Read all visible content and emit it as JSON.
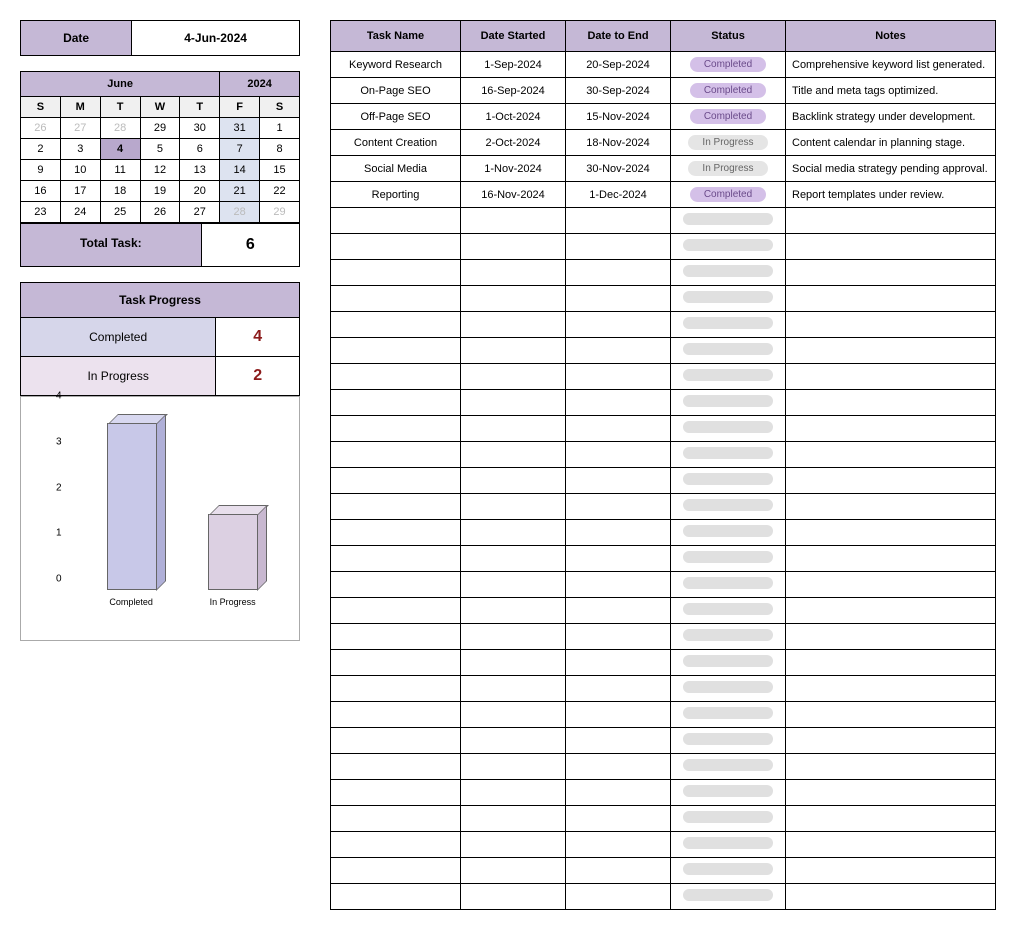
{
  "date": {
    "label": "Date",
    "value": "4-Jun-2024"
  },
  "calendar": {
    "month": "June",
    "year": "2024",
    "days": [
      "S",
      "M",
      "T",
      "W",
      "T",
      "F",
      "S"
    ],
    "weeks": [
      [
        {
          "d": "26",
          "adj": true
        },
        {
          "d": "27",
          "adj": true
        },
        {
          "d": "28",
          "adj": true
        },
        {
          "d": "29"
        },
        {
          "d": "30"
        },
        {
          "d": "31",
          "fri": true
        },
        {
          "d": "1"
        }
      ],
      [
        {
          "d": "2"
        },
        {
          "d": "3"
        },
        {
          "d": "4",
          "today": true
        },
        {
          "d": "5"
        },
        {
          "d": "6"
        },
        {
          "d": "7",
          "fri": true
        },
        {
          "d": "8"
        }
      ],
      [
        {
          "d": "9"
        },
        {
          "d": "10"
        },
        {
          "d": "11"
        },
        {
          "d": "12"
        },
        {
          "d": "13"
        },
        {
          "d": "14",
          "fri": true
        },
        {
          "d": "15"
        }
      ],
      [
        {
          "d": "16"
        },
        {
          "d": "17"
        },
        {
          "d": "18"
        },
        {
          "d": "19"
        },
        {
          "d": "20"
        },
        {
          "d": "21",
          "fri": true
        },
        {
          "d": "22"
        }
      ],
      [
        {
          "d": "23"
        },
        {
          "d": "24"
        },
        {
          "d": "25"
        },
        {
          "d": "26"
        },
        {
          "d": "27"
        },
        {
          "d": "28",
          "adj": true,
          "fri": true
        },
        {
          "d": "29",
          "adj": true
        }
      ]
    ]
  },
  "total": {
    "label": "Total Task:",
    "value": "6"
  },
  "progress": {
    "header": "Task Progress",
    "rows": [
      {
        "label": "Completed",
        "value": "4",
        "cls": "progress-completed-label"
      },
      {
        "label": "In Progress",
        "value": "2",
        "cls": "progress-inprogress-label"
      }
    ]
  },
  "chart_data": {
    "type": "bar",
    "categories": [
      "Completed",
      "In Progress"
    ],
    "values": [
      3.7,
      1.7
    ],
    "title": "",
    "xlabel": "",
    "ylabel": "",
    "ylim": [
      0,
      4
    ],
    "yticks": [
      0,
      1,
      2,
      3,
      4
    ]
  },
  "tasks": {
    "headers": [
      "Task Name",
      "Date Started",
      "Date to End",
      "Status",
      "Notes"
    ],
    "rows": [
      {
        "name": "Keyword Research",
        "start": "1-Sep-2024",
        "end": "20-Sep-2024",
        "status": "Completed",
        "status_cls": "pill-completed",
        "notes": "Comprehensive keyword list generated."
      },
      {
        "name": "On-Page SEO",
        "start": "16-Sep-2024",
        "end": "30-Sep-2024",
        "status": "Completed",
        "status_cls": "pill-completed",
        "notes": "Title and meta tags optimized."
      },
      {
        "name": "Off-Page SEO",
        "start": "1-Oct-2024",
        "end": "15-Nov-2024",
        "status": "Completed",
        "status_cls": "pill-completed",
        "notes": "Backlink strategy under development."
      },
      {
        "name": "Content Creation",
        "start": "2-Oct-2024",
        "end": "18-Nov-2024",
        "status": "In Progress",
        "status_cls": "pill-inprogress",
        "notes": "Content calendar in planning stage."
      },
      {
        "name": "Social Media",
        "start": "1-Nov-2024",
        "end": "30-Nov-2024",
        "status": "In Progress",
        "status_cls": "pill-inprogress",
        "notes": "Social media strategy pending approval."
      },
      {
        "name": "Reporting",
        "start": "16-Nov-2024",
        "end": "1-Dec-2024",
        "status": "Completed",
        "status_cls": "pill-completed",
        "notes": "Report templates under review."
      }
    ],
    "empty_rows": 27
  }
}
